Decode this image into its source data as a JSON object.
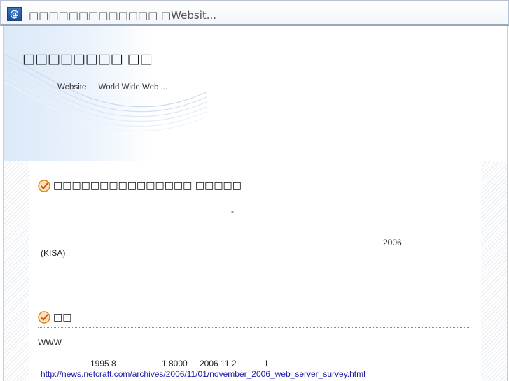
{
  "window": {
    "icon_glyph": "@",
    "title": "□□□□□□□□□□□□□ □Websit..."
  },
  "header": {
    "title": "□□□□□□□□ □□",
    "subtitle_1": "Website",
    "subtitle_2": "World Wide Web ..."
  },
  "sections": [
    {
      "heading": "□□□□□□□□□□□□□□□ □□□□□",
      "lines": [
        "-",
        "2006",
        "(KISA)"
      ]
    },
    {
      "heading": "□□",
      "lines": [
        "WWW",
        "1995 8",
        "1 8000",
        "2006 11 2",
        "1"
      ],
      "link": "http://news.netcraft.com/archives/2006/11/01/november_2006_web_server_survey.html"
    }
  ],
  "colors": {
    "check_icon": "#f0a020",
    "link": "#1a1aa6"
  },
  "icons": [
    "at-icon",
    "check-circle-icon"
  ]
}
